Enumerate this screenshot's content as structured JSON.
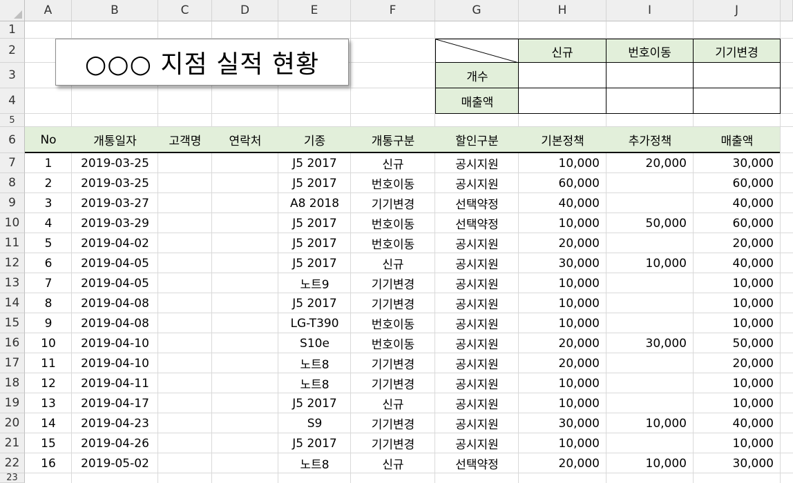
{
  "columns": [
    "A",
    "B",
    "C",
    "D",
    "E",
    "F",
    "G",
    "H",
    "I",
    "J"
  ],
  "rows": [
    "1",
    "2",
    "3",
    "4",
    "5",
    "6",
    "7",
    "8",
    "9",
    "10",
    "11",
    "12",
    "13",
    "14",
    "15",
    "16",
    "17",
    "18",
    "19",
    "20",
    "21",
    "22",
    "23"
  ],
  "title": "○○○ 지점  실적 현황",
  "summary": {
    "headers": [
      "신규",
      "번호이동",
      "기기변경"
    ],
    "row_labels": [
      "개수",
      "매출액"
    ]
  },
  "table": {
    "headers": [
      "No",
      "개통일자",
      "고객명",
      "연락처",
      "기종",
      "개통구분",
      "할인구분",
      "기본정책",
      "추가정책",
      "매출액"
    ],
    "rows": [
      [
        "1",
        "2019-03-25",
        "",
        "",
        "J5 2017",
        "신규",
        "공시지원",
        "10,000",
        "20,000",
        "30,000"
      ],
      [
        "2",
        "2019-03-25",
        "",
        "",
        "J5 2017",
        "번호이동",
        "공시지원",
        "60,000",
        "",
        "60,000"
      ],
      [
        "3",
        "2019-03-27",
        "",
        "",
        "A8 2018",
        "기기변경",
        "선택약정",
        "40,000",
        "",
        "40,000"
      ],
      [
        "4",
        "2019-03-29",
        "",
        "",
        "J5 2017",
        "번호이동",
        "선택약정",
        "10,000",
        "50,000",
        "60,000"
      ],
      [
        "5",
        "2019-04-02",
        "",
        "",
        "J5 2017",
        "번호이동",
        "공시지원",
        "20,000",
        "",
        "20,000"
      ],
      [
        "6",
        "2019-04-05",
        "",
        "",
        "J5 2017",
        "신규",
        "공시지원",
        "30,000",
        "10,000",
        "40,000"
      ],
      [
        "7",
        "2019-04-05",
        "",
        "",
        "노트9",
        "기기변경",
        "공시지원",
        "10,000",
        "",
        "10,000"
      ],
      [
        "8",
        "2019-04-08",
        "",
        "",
        "J5 2017",
        "기기변경",
        "공시지원",
        "10,000",
        "",
        "10,000"
      ],
      [
        "9",
        "2019-04-08",
        "",
        "",
        "LG-T390",
        "번호이동",
        "공시지원",
        "10,000",
        "",
        "10,000"
      ],
      [
        "10",
        "2019-04-10",
        "",
        "",
        "S10e",
        "번호이동",
        "공시지원",
        "20,000",
        "30,000",
        "50,000"
      ],
      [
        "11",
        "2019-04-10",
        "",
        "",
        "노트8",
        "기기변경",
        "공시지원",
        "20,000",
        "",
        "20,000"
      ],
      [
        "12",
        "2019-04-11",
        "",
        "",
        "노트8",
        "기기변경",
        "공시지원",
        "10,000",
        "",
        "10,000"
      ],
      [
        "13",
        "2019-04-17",
        "",
        "",
        "J5 2017",
        "신규",
        "공시지원",
        "10,000",
        "",
        "10,000"
      ],
      [
        "14",
        "2019-04-23",
        "",
        "",
        "S9",
        "기기변경",
        "공시지원",
        "30,000",
        "10,000",
        "40,000"
      ],
      [
        "15",
        "2019-04-26",
        "",
        "",
        "J5 2017",
        "기기변경",
        "공시지원",
        "10,000",
        "",
        "10,000"
      ],
      [
        "16",
        "2019-05-02",
        "",
        "",
        "노트8",
        "신규",
        "선택약정",
        "20,000",
        "10,000",
        "30,000"
      ]
    ]
  },
  "colors": {
    "header_fill": "#e2efda",
    "gridline": "#d9d9d9",
    "heading_bg": "#efefef"
  }
}
